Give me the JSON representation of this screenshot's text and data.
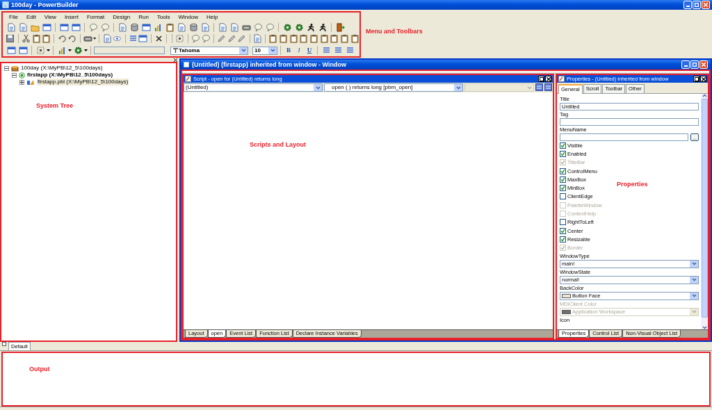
{
  "window": {
    "title": "100day - PowerBuilder"
  },
  "menu": [
    "File",
    "Edit",
    "View",
    "Insert",
    "Format",
    "Design",
    "Run",
    "Tools",
    "Window",
    "Help"
  ],
  "format_bar": {
    "font": "Tahoma",
    "size": "10",
    "style_buttons": [
      "B",
      "I",
      "U"
    ]
  },
  "toolbars_annotation": "Menu and Toolbars",
  "system_tree": {
    "annotation": "System Tree",
    "items": [
      {
        "label": "100day (X:\\MyPB\\12_5\\100days)",
        "expanded": true,
        "current": false,
        "selected": false,
        "children": [
          {
            "label": "firstapp (X:\\MyPB\\12_5\\100days)",
            "expanded": true,
            "current": true,
            "selected": false,
            "children": [
              {
                "label": "firstapp.pbl (X:\\MyPB\\12_5\\100days)",
                "expanded": false,
                "current": false,
                "selected": true
              }
            ]
          }
        ]
      }
    ]
  },
  "sheet": {
    "title": "(Untitled) (firstapp) inherited from window - Window",
    "script": {
      "title": "Script - open for (Untitled) returns long",
      "object": "(Untitled)",
      "event": "open ( )  returns long [pbm_open]",
      "annotation": "Scripts and Layout",
      "tabs": [
        {
          "label": "Layout",
          "selected": false
        },
        {
          "label": "open",
          "selected": true
        },
        {
          "label": "Event List",
          "selected": false
        },
        {
          "label": "Function List",
          "selected": false
        },
        {
          "label": "Declare Instance Variables",
          "selected": false
        }
      ]
    },
    "properties": {
      "title": "Properties - (Untitled) inherited from window",
      "annotation": "Properties",
      "browse_label": "...",
      "tabs": [
        {
          "label": "General",
          "selected": true
        },
        {
          "label": "Scroll",
          "selected": false
        },
        {
          "label": "Toolbar",
          "selected": false
        },
        {
          "label": "Other",
          "selected": false
        }
      ],
      "fields": [
        {
          "kind": "text",
          "label": "Title",
          "value": "Untitled"
        },
        {
          "kind": "text",
          "label": "Tag"
        },
        {
          "kind": "browse",
          "label": "MenuName"
        },
        {
          "kind": "check",
          "label": "Visible",
          "checked": true,
          "disabled": false
        },
        {
          "kind": "check",
          "label": "Enabled",
          "checked": true,
          "disabled": false
        },
        {
          "kind": "check",
          "label": "TitleBar",
          "checked": true,
          "disabled": true
        },
        {
          "kind": "check",
          "label": "ControlMenu",
          "checked": true,
          "disabled": false
        },
        {
          "kind": "check",
          "label": "MaxBox",
          "checked": true,
          "disabled": false
        },
        {
          "kind": "check",
          "label": "MinBox",
          "checked": true,
          "disabled": false
        },
        {
          "kind": "check",
          "label": "ClientEdge",
          "checked": false,
          "disabled": false
        },
        {
          "kind": "check",
          "label": "PaletteWindow",
          "checked": false,
          "disabled": true
        },
        {
          "kind": "check",
          "label": "ContextHelp",
          "checked": false,
          "disabled": true
        },
        {
          "kind": "check",
          "label": "RightToLeft",
          "checked": false,
          "disabled": false
        },
        {
          "kind": "check",
          "label": "Center",
          "checked": true,
          "disabled": false
        },
        {
          "kind": "check",
          "label": "Resizable",
          "checked": true,
          "disabled": false
        },
        {
          "kind": "check",
          "label": "Border",
          "checked": true,
          "disabled": true
        },
        {
          "kind": "select",
          "label": "WindowType",
          "value": "main!",
          "disabled": false
        },
        {
          "kind": "select",
          "label": "WindowState",
          "value": "normal!",
          "disabled": false
        },
        {
          "kind": "color",
          "label": "BackColor",
          "value": "Button Face",
          "color": "#ece9d8",
          "disabled": false
        },
        {
          "kind": "color",
          "label": "MDIClient Color",
          "value": "Application Workspace",
          "color": "#6f6f6f",
          "disabled": true
        },
        {
          "kind": "label",
          "label": "Icon",
          "disabled": false
        }
      ],
      "bottom_tabs": [
        {
          "label": "Properties",
          "selected": true
        },
        {
          "label": "Control List",
          "selected": false
        },
        {
          "label": "Non-Visual Object List",
          "selected": false
        }
      ]
    }
  },
  "output": {
    "annotation": "Output",
    "tabs": [
      {
        "label": "Default",
        "selected": true
      }
    ]
  }
}
